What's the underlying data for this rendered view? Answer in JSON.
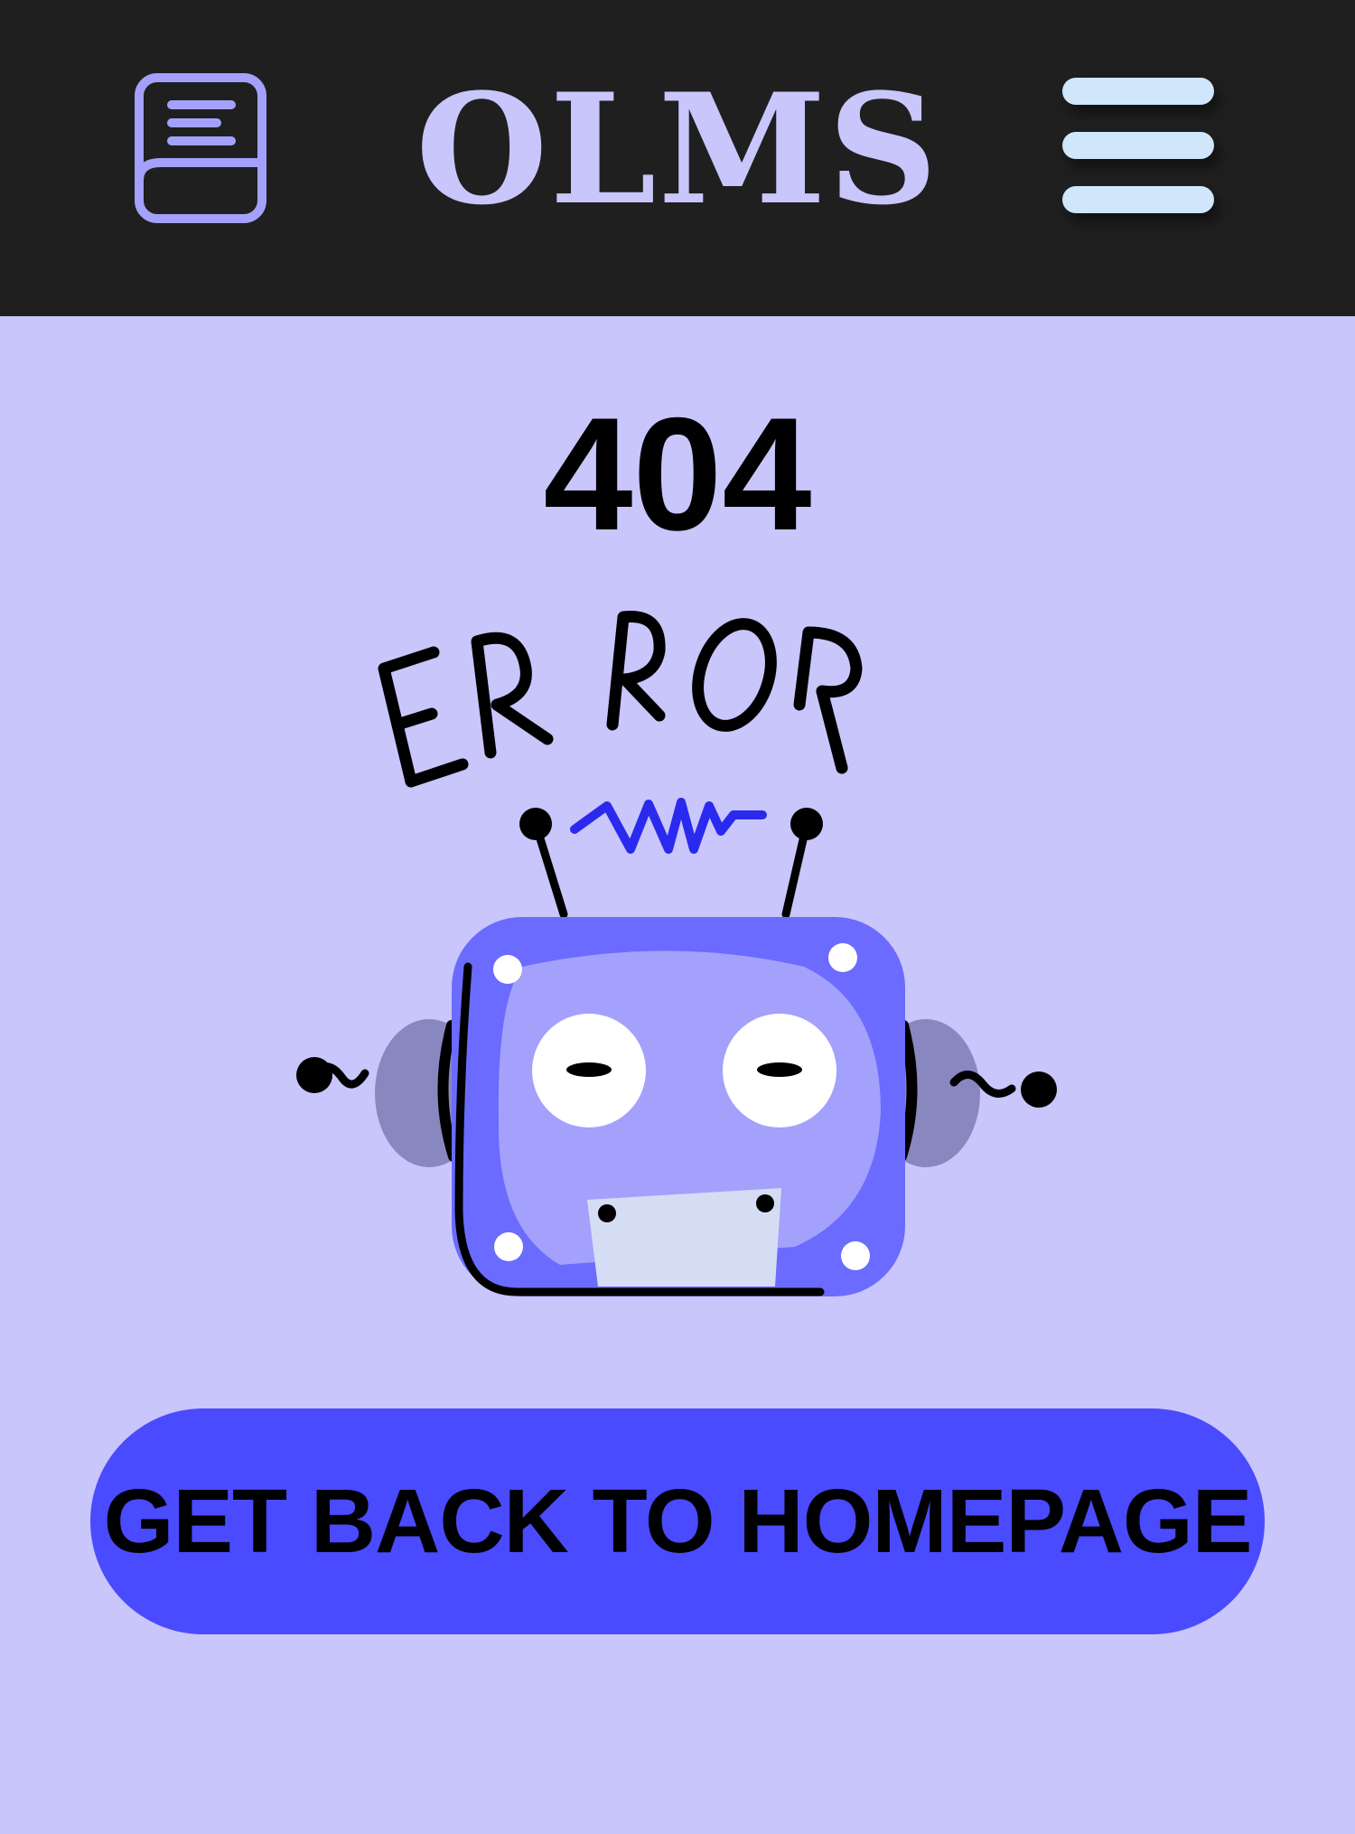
{
  "header": {
    "brand": "OLMS",
    "logo_icon": "book-icon",
    "menu_icon": "hamburger-menu-icon"
  },
  "error": {
    "code": "404",
    "illustration_text": "ERROR",
    "illustration_icon": "broken-robot-icon"
  },
  "actions": {
    "home_label": "GET BACK TO HOMEPAGE"
  },
  "colors": {
    "header_bg": "#1f1f1f",
    "page_bg": "#c8c6fb",
    "brand": "#c8c6fb",
    "menu_bars": "#cfe6fb",
    "button_bg": "#4a4aff",
    "robot_body": "#6b6bff",
    "robot_face": "#a3a1fb"
  }
}
